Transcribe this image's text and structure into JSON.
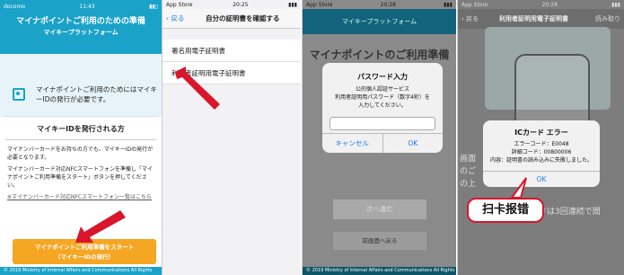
{
  "panel1": {
    "status_left": "docomo",
    "status_time": "11:43",
    "header_title": "マイナポイントご利用のための準備",
    "header_sub": "マイキープラットフォーム",
    "card_text": "マイナポイントご利用のためにはマイキーIDの発行が必要です。",
    "section_title": "マイキーIDを発行される方",
    "para1": "マイナンバーカードをお持ちの方でも、マイキーIDの発行が必要となります。",
    "para2": "マイナンバーカード対応NFCスマートフォンを準備し「マイナポイントご利用準備をスタート」ボタンを押してください。",
    "link_text": "※マイナンバーカード対応NFCスマートフォン一覧はこちら",
    "button_line1": "マイナポイントご利用準備をスタート",
    "button_line2": "（マイキーIDの発行）",
    "footer": "© 2019 Ministry of Internal Affairs and Communications All Rights Reserved."
  },
  "panel2": {
    "status_left": "App Store",
    "status_time": "20:25",
    "back_label": "戻る",
    "title": "自分の証明書を確認する",
    "items": [
      "署名用電子証明書",
      "利用者証明用電子証明書"
    ]
  },
  "panel3": {
    "status_left": "App Store",
    "status_time": "20:28",
    "header_sub": "マイキープラットフォーム",
    "page_title": "マイナポイントのご利用準備",
    "dialog_title": "パスワード入力",
    "dialog_line1": "公的個人認証サービス",
    "dialog_line2": "利用者証明用パスワード（数字4桁）を",
    "dialog_line3": "入力してください。",
    "cancel_label": "キャンセル",
    "ok_label": "OK",
    "next_label": "次へ進む",
    "prev_label": "前画面へ戻る",
    "footer": "© 2019 Ministry of Internal Affairs and Communications All Rights Reserved."
  },
  "panel4": {
    "status_left": "App Store",
    "status_time": "20:29",
    "back_label": "戻る",
    "title": "利用者証明用電子証明書",
    "right_label": "読み取り",
    "error_title": "ICカード エラー",
    "error_code": "エラーコード：E0048",
    "detail_code": "詳細コード：00800006",
    "error_content": "内容：証明書の読み込みに失敗しました。",
    "ok_label": "OK",
    "bg_text": "ドは3回連続で間",
    "badge_text": "扫卡报错"
  },
  "colors": {
    "brand_blue": "#1aa2c9",
    "orange_button": "#f5a623",
    "ios_link": "#1a7cf0",
    "annotation_red": "#d9162b"
  }
}
